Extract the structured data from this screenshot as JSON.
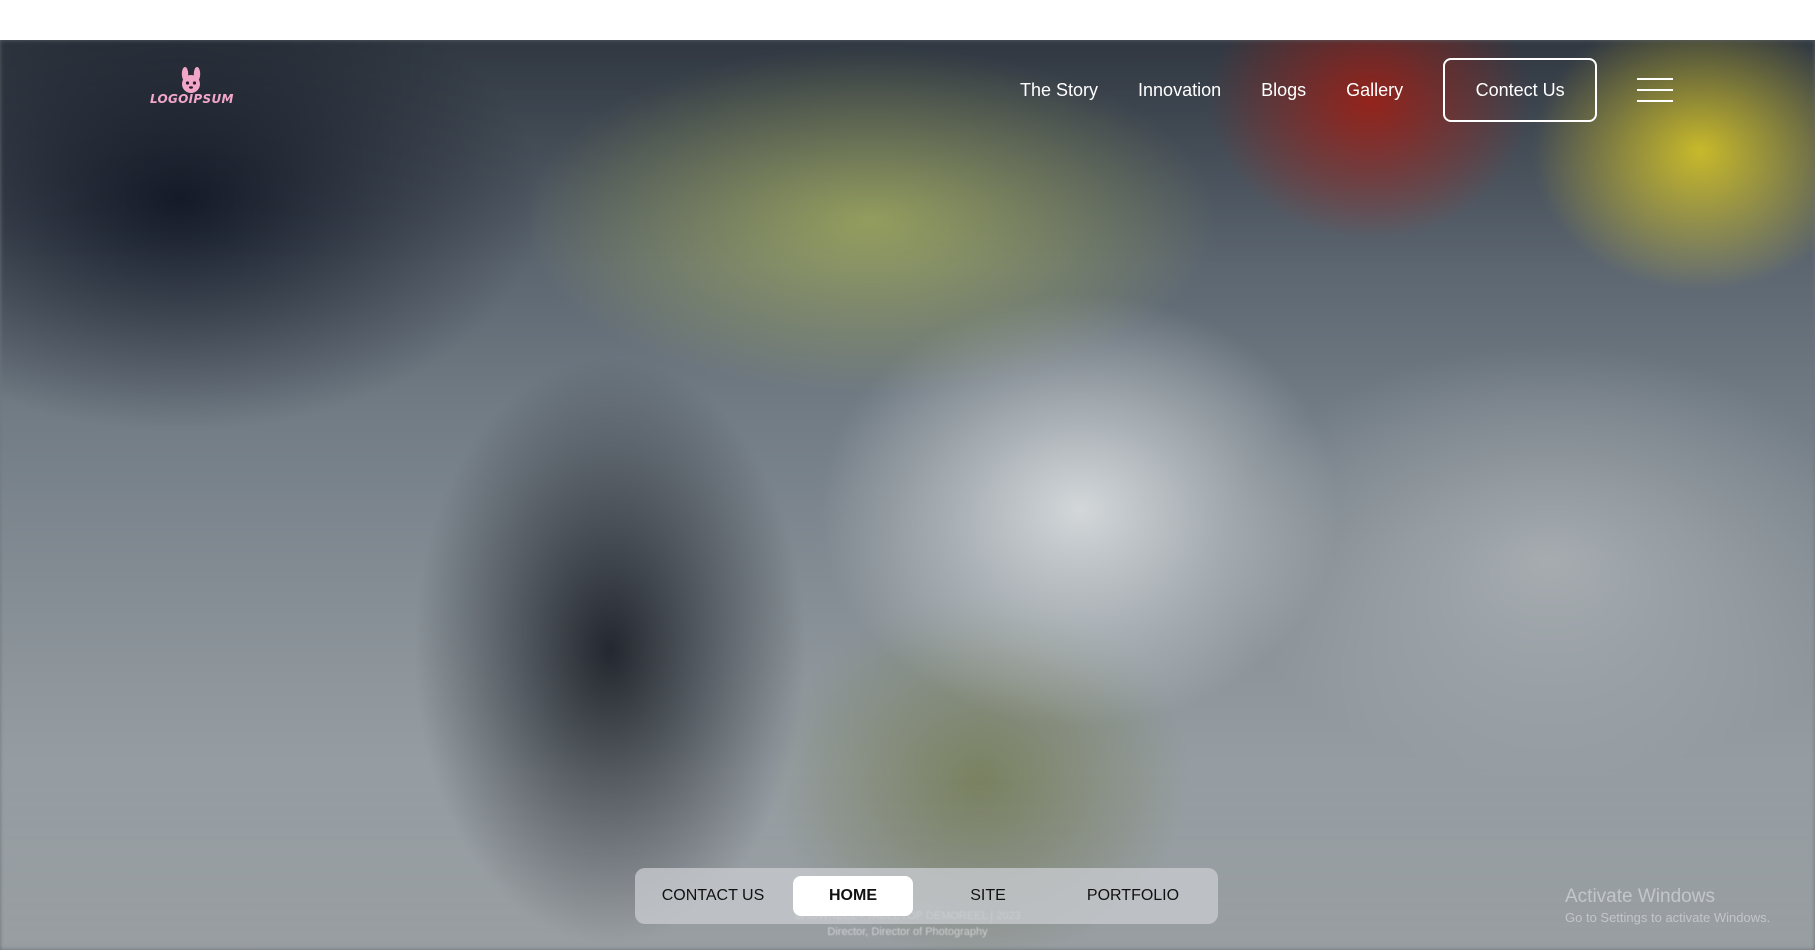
{
  "header": {
    "logo_text": "LOGOIPSUM",
    "logo_color": "#f2a7c9",
    "logo_icon": "rabbit-icon"
  },
  "nav": {
    "items": [
      {
        "label": "The Story"
      },
      {
        "label": "Innovation"
      },
      {
        "label": "Blogs"
      },
      {
        "label": "Gallery"
      }
    ],
    "cta_label": "Contect Us",
    "menu_icon": "hamburger-menu-icon"
  },
  "bottom_nav": {
    "items": [
      {
        "label": "CONTACT US",
        "active": false
      },
      {
        "label": "HOME",
        "active": true
      },
      {
        "label": "SITE",
        "active": false
      },
      {
        "label": "PORTFOLIO",
        "active": false
      }
    ]
  },
  "credits": {
    "line1": "SHOWREEL • TABLETOP DEMOREEL | 2023",
    "line2": "Director, Director of Photography"
  },
  "watermark": {
    "title": "Activate Windows",
    "subtitle": "Go to Settings to activate Windows."
  }
}
